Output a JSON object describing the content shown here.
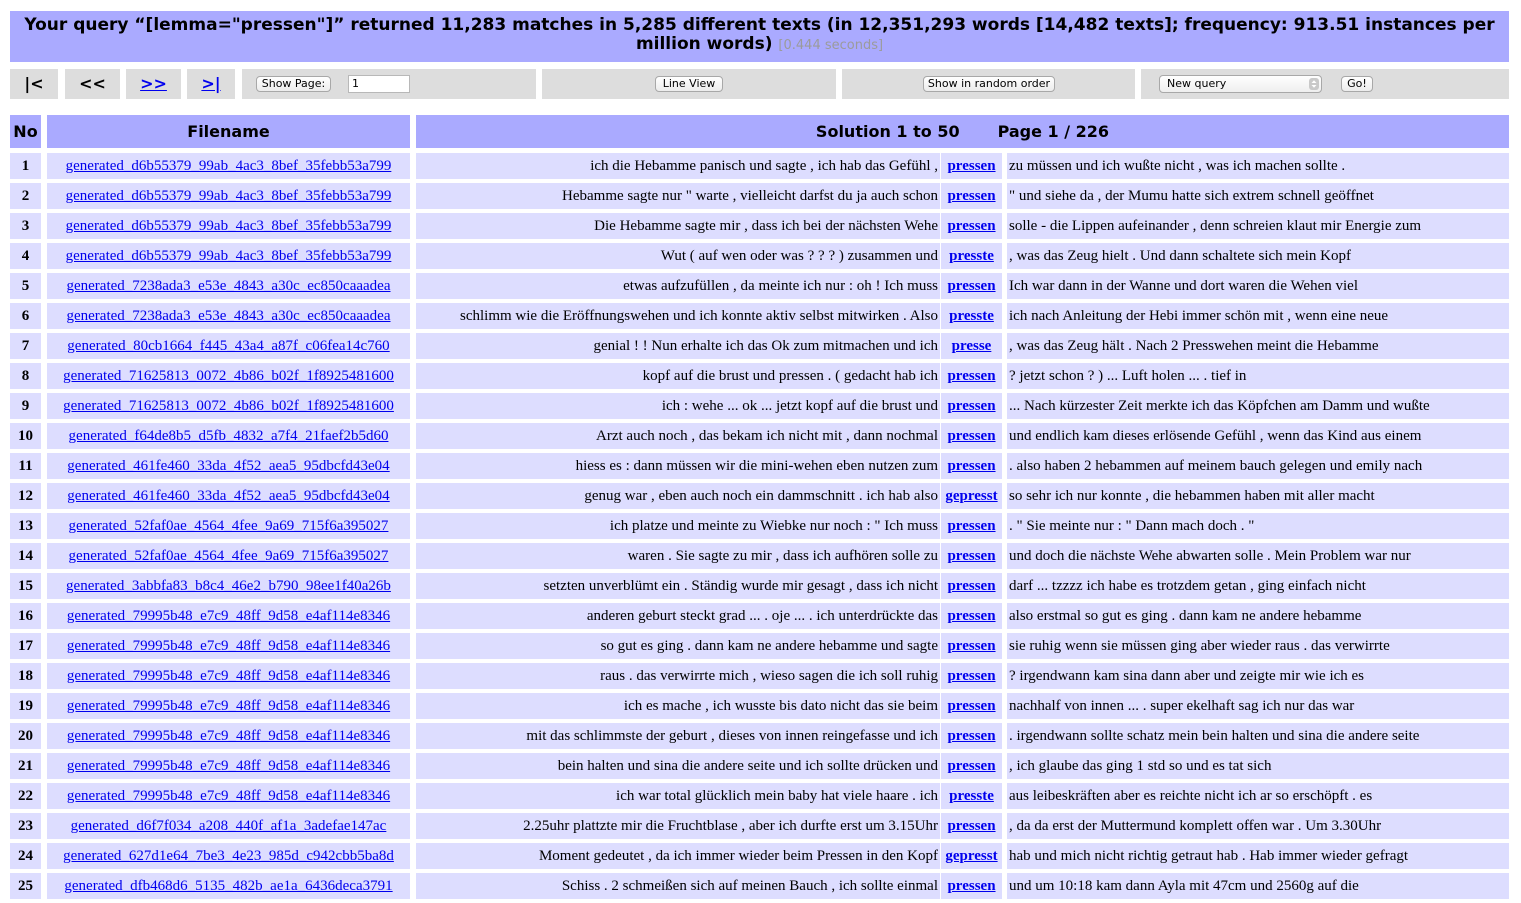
{
  "query": {
    "text": "Your query “[lemma=\"pressen\"]” returned 11,283 matches in 5,285 different texts (in 12,351,293 words [14,482 texts]; frequency: 913.51 instances per million words)",
    "seconds": "[0.444 seconds]"
  },
  "toolbar": {
    "first": "|<",
    "prev": "<<",
    "next": ">>",
    "last": ">|",
    "show_page_label": "Show Page:",
    "page_value": "1",
    "line_view_label": "Line View",
    "random_label": "Show in random order",
    "query_select": "New query",
    "go_label": "Go!"
  },
  "table": {
    "no_header": "No",
    "file_header": "Filename",
    "solution": "Solution 1 to 50",
    "page": "Page 1 / 226"
  },
  "rows": [
    {
      "no": "1",
      "file": "generated_d6b55379_99ab_4ac3_8bef_35febb53a799",
      "left": "ich die Hebamme panisch und sagte , ich hab das Gefühl ,",
      "match": "pressen",
      "right": "zu müssen und ich wußte nicht , was ich machen sollte ."
    },
    {
      "no": "2",
      "file": "generated_d6b55379_99ab_4ac3_8bef_35febb53a799",
      "left": "Hebamme sagte nur \" warte , vielleicht darfst du ja auch schon",
      "match": "pressen",
      "right": "\" und siehe da , der Mumu hatte sich extrem schnell geöffnet"
    },
    {
      "no": "3",
      "file": "generated_d6b55379_99ab_4ac3_8bef_35febb53a799",
      "left": "Die Hebamme sagte mir , dass ich bei der nächsten Wehe",
      "match": "pressen",
      "right": "solle - die Lippen aufeinander , denn schreien klaut mir Energie zum"
    },
    {
      "no": "4",
      "file": "generated_d6b55379_99ab_4ac3_8bef_35febb53a799",
      "left": "Wut ( auf wen oder was ? ? ? ) zusammen und",
      "match": "presste",
      "right": ", was das Zeug hielt . Und dann schaltete sich mein Kopf"
    },
    {
      "no": "5",
      "file": "generated_7238ada3_e53e_4843_a30c_ec850caaadea",
      "left": "etwas aufzufüllen , da meinte ich nur : oh ! Ich muss",
      "match": "pressen",
      "right": "Ich war dann in der Wanne und dort waren die Wehen viel"
    },
    {
      "no": "6",
      "file": "generated_7238ada3_e53e_4843_a30c_ec850caaadea",
      "left": "schlimm wie die Eröffnungswehen und ich konnte aktiv selbst mitwirken . Also",
      "match": "presste",
      "right": "ich nach Anleitung der Hebi immer schön mit , wenn eine neue"
    },
    {
      "no": "7",
      "file": "generated_80cb1664_f445_43a4_a87f_c06fea14c760",
      "left": "genial ! ! Nun erhalte ich das Ok zum mitmachen und ich",
      "match": "presse",
      "right": ", was das Zeug hält . Nach 2 Presswehen meint die Hebamme"
    },
    {
      "no": "8",
      "file": "generated_71625813_0072_4b86_b02f_1f8925481600",
      "left": "kopf auf die brust und pressen . ( gedacht hab ich",
      "match": "pressen",
      "right": "? jetzt schon ? ) ... Luft holen ... . tief in"
    },
    {
      "no": "9",
      "file": "generated_71625813_0072_4b86_b02f_1f8925481600",
      "left": "ich : wehe ... ok ... jetzt kopf auf die brust und",
      "match": "pressen",
      "right": "... Nach kürzester Zeit merkte ich das Köpfchen am Damm und wußte"
    },
    {
      "no": "10",
      "file": "generated_f64de8b5_d5fb_4832_a7f4_21faef2b5d60",
      "left": "Arzt auch noch , das bekam ich nicht mit , dann nochmal",
      "match": "pressen",
      "right": "und endlich kam dieses erlösende Gefühl , wenn das Kind aus einem"
    },
    {
      "no": "11",
      "file": "generated_461fe460_33da_4f52_aea5_95dbcfd43e04",
      "left": "hiess es : dann müssen wir die mini-wehen eben nutzen zum",
      "match": "pressen",
      "right": ". also haben 2 hebammen auf meinem bauch gelegen und emily nach"
    },
    {
      "no": "12",
      "file": "generated_461fe460_33da_4f52_aea5_95dbcfd43e04",
      "left": "genug war , eben auch noch ein dammschnitt . ich hab also",
      "match": "gepresst",
      "right": "so sehr ich nur konnte , die hebammen haben mit aller macht"
    },
    {
      "no": "13",
      "file": "generated_52faf0ae_4564_4fee_9a69_715f6a395027",
      "left": "ich platze und meinte zu Wiebke nur noch : \" Ich muss",
      "match": "pressen",
      "right": ". \" Sie meinte nur : \" Dann mach doch . \""
    },
    {
      "no": "14",
      "file": "generated_52faf0ae_4564_4fee_9a69_715f6a395027",
      "left": "waren . Sie sagte zu mir , dass ich aufhören solle zu",
      "match": "pressen",
      "right": "und doch die nächste Wehe abwarten solle . Mein Problem war nur"
    },
    {
      "no": "15",
      "file": "generated_3abbfa83_b8c4_46e2_b790_98ee1f40a26b",
      "left": "setzten unverblümt ein . Ständig wurde mir gesagt , dass ich nicht",
      "match": "pressen",
      "right": "darf ... tzzzz ich habe es trotzdem getan , ging einfach nicht"
    },
    {
      "no": "16",
      "file": "generated_79995b48_e7c9_48ff_9d58_e4af114e8346",
      "left": "anderen geburt steckt grad ... . oje ... . ich unterdrückte das",
      "match": "pressen",
      "right": "also erstmal so gut es ging . dann kam ne andere hebamme"
    },
    {
      "no": "17",
      "file": "generated_79995b48_e7c9_48ff_9d58_e4af114e8346",
      "left": "so gut es ging . dann kam ne andere hebamme und sagte",
      "match": "pressen",
      "right": "sie ruhig wenn sie müssen ging aber wieder raus . das verwirrte"
    },
    {
      "no": "18",
      "file": "generated_79995b48_e7c9_48ff_9d58_e4af114e8346",
      "left": "raus . das verwirrte mich , wieso sagen die ich soll ruhig",
      "match": "pressen",
      "right": "? irgendwann kam sina dann aber und zeigte mir wie ich es"
    },
    {
      "no": "19",
      "file": "generated_79995b48_e7c9_48ff_9d58_e4af114e8346",
      "left": "ich es mache , ich wusste bis dato nicht das sie beim",
      "match": "pressen",
      "right": "nachhalf von innen ... . super ekelhaft sag ich nur das war"
    },
    {
      "no": "20",
      "file": "generated_79995b48_e7c9_48ff_9d58_e4af114e8346",
      "left": "mit das schlimmste der geburt , dieses von innen reingefasse und ich",
      "match": "pressen",
      "right": ". irgendwann sollte schatz mein bein halten und sina die andere seite"
    },
    {
      "no": "21",
      "file": "generated_79995b48_e7c9_48ff_9d58_e4af114e8346",
      "left": "bein halten und sina die andere seite und ich sollte drücken und",
      "match": "pressen",
      "right": ", ich glaube das ging 1 std so und es tat sich"
    },
    {
      "no": "22",
      "file": "generated_79995b48_e7c9_48ff_9d58_e4af114e8346",
      "left": "ich war total glücklich mein baby hat viele haare . ich",
      "match": "presste",
      "right": "aus leibeskräften aber es reichte nicht ich ar so erschöpft . es"
    },
    {
      "no": "23",
      "file": "generated_d6f7f034_a208_440f_af1a_3adefae147ac",
      "left": "2.25uhr plattzte mir die Fruchtblase , aber ich durfte erst um 3.15Uhr",
      "match": "pressen",
      "right": ", da da erst der Muttermund komplett offen war . Um 3.30Uhr"
    },
    {
      "no": "24",
      "file": "generated_627d1e64_7be3_4e23_985d_c942cbb5ba8d",
      "left": "Moment gedeutet , da ich immer wieder beim Pressen in den Kopf",
      "match": "gepresst",
      "right": "hab und mich nicht richtig getraut hab . Hab immer wieder gefragt"
    },
    {
      "no": "25",
      "file": "generated_dfb468d6_5135_482b_ae1a_6436deca3791",
      "left": "Schiss . 2 schmeißen sich auf meinen Bauch , ich sollte einmal",
      "match": "pressen",
      "right": "und um 10:18 kam dann Ayla mit 47cm und 2560g auf die"
    }
  ]
}
